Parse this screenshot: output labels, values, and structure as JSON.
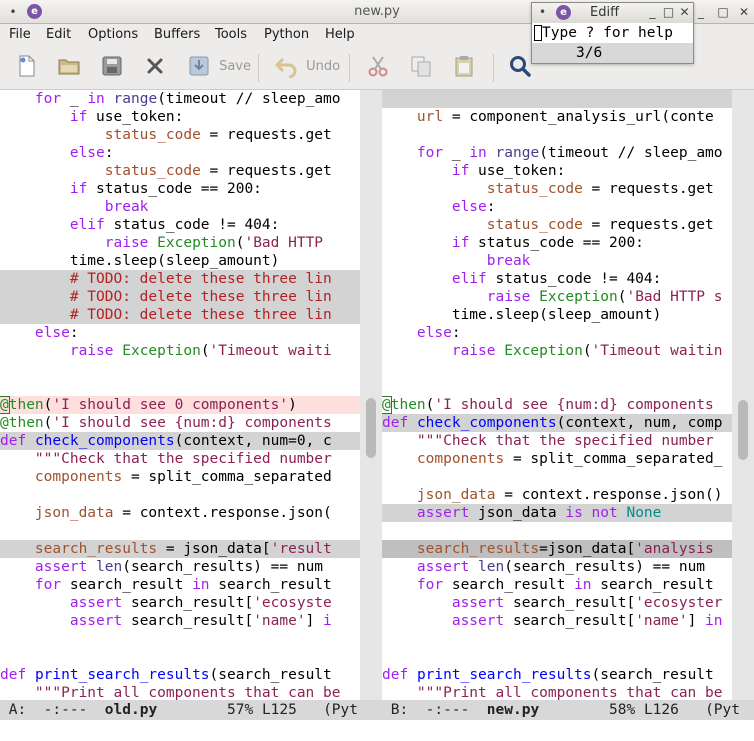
{
  "window": {
    "title": "new.py"
  },
  "menu": [
    "File",
    "Edit",
    "Options",
    "Buffers",
    "Tools",
    "Python",
    "Help"
  ],
  "toolbar": {
    "save_label": "Save",
    "undo_label": "Undo"
  },
  "ediff": {
    "title": "Ediff",
    "help": "Type ? for help",
    "position": "3/6"
  },
  "left": {
    "modeline": {
      "window": "A:",
      "state": "-:---",
      "file": "old.py",
      "pos": "57% L125",
      "mode": "(Pyt"
    }
  },
  "right": {
    "modeline": {
      "window": "B:",
      "state": "-:---",
      "file": "new.py",
      "pos": "58% L126",
      "mode": "(Pyt"
    }
  },
  "colors": {
    "diff_current": "#d3d3d3",
    "diff_fine": "#bfbfbf",
    "diff_removed": "#ffdede",
    "modeline": "#d8d8d8"
  }
}
